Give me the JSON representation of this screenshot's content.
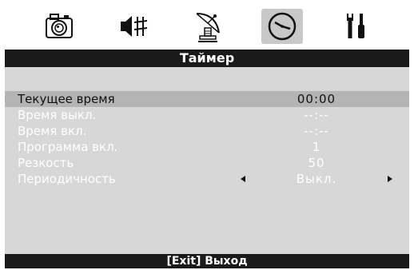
{
  "header": {
    "tabs": [
      {
        "icon": "camera-icon",
        "active": false
      },
      {
        "icon": "audio-icon",
        "active": false
      },
      {
        "icon": "satellite-dish-icon",
        "active": false
      },
      {
        "icon": "clock-icon",
        "active": true
      },
      {
        "icon": "tools-icon",
        "active": false
      }
    ]
  },
  "title": "Таймер",
  "items": [
    {
      "label": "Текущее время",
      "value": "00:00",
      "selected": true
    },
    {
      "label": "Время выкл.",
      "value": "--:--"
    },
    {
      "label": "Время вкл.",
      "value": "--:--"
    },
    {
      "label": "Программа вкл.",
      "value": "1"
    },
    {
      "label": "Резкость",
      "value": "50"
    },
    {
      "label": "Периодичность",
      "value": "Выкл.",
      "has_arrows": true
    }
  ],
  "footer": {
    "hint": "[Exit] Выход"
  },
  "colors": {
    "panel": "#d7d7d7",
    "bar": "#1a1a1a",
    "selected_row": "#b4b4b4",
    "active_tab": "#c8c8c8"
  }
}
